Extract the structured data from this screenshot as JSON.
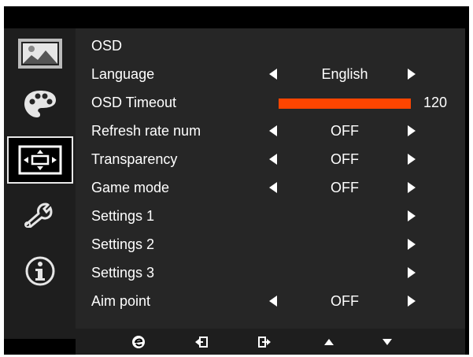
{
  "menu": {
    "title": "OSD",
    "rows": [
      {
        "label": "Language",
        "value": "English"
      },
      {
        "label": "OSD Timeout",
        "level": 1.0,
        "value": "120"
      },
      {
        "label": "Refresh rate num",
        "value": "OFF"
      },
      {
        "label": "Transparency",
        "value": "OFF"
      },
      {
        "label": "Game mode",
        "value": "OFF"
      },
      {
        "label": "Settings 1"
      },
      {
        "label": "Settings 2"
      },
      {
        "label": "Settings 3"
      },
      {
        "label": "Aim point",
        "value": "OFF"
      }
    ]
  },
  "sidebar": {
    "items": [
      {
        "icon": "picture-icon"
      },
      {
        "icon": "palette-icon"
      },
      {
        "icon": "osd-position-icon",
        "selected": true
      },
      {
        "icon": "wrench-icon"
      },
      {
        "icon": "info-icon"
      }
    ]
  },
  "footer": {
    "buttons": [
      {
        "icon": "e-logo-icon"
      },
      {
        "icon": "back-icon"
      },
      {
        "icon": "enter-icon"
      },
      {
        "icon": "up-arrow-icon"
      },
      {
        "icon": "down-arrow-icon"
      }
    ]
  },
  "colors": {
    "accent": "#ff4500",
    "panel": "#262626",
    "sidebar": "#1e1e1e",
    "text": "#ffffff"
  }
}
